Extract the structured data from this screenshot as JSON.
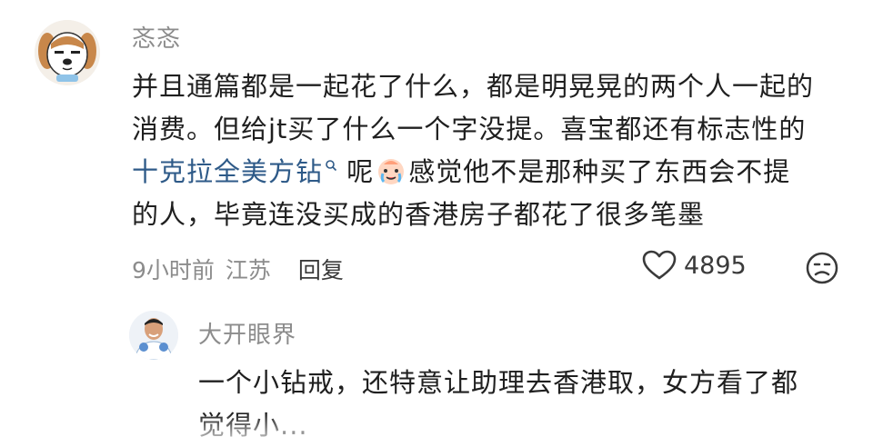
{
  "comment": {
    "username": "忞忞",
    "lines": [
      "并且通篇都是一起花了什么，都是明晃晃的两个人一起的",
      "消费。但给jt买了什么一个字没提。喜宝都还有标志性的"
    ],
    "line3_link": "十克拉全美方钻",
    "line3_after_link": " 呢",
    "line3_rest": "感觉他不是那种买了东西会不提",
    "line4": "的人，毕竟连没买成的香港房子都花了很多笔墨",
    "time": "9小时前",
    "location": "江苏",
    "reply_label": "回复",
    "like_count": "4895"
  },
  "reply": {
    "username": "大开眼界",
    "line1": "一个小钻戒，还特意让助理去香港取，女方看了都",
    "line2": "觉得小..."
  },
  "icons": {
    "like": "heart-outline-icon",
    "dislike": "frown-face-icon",
    "search": "search-icon",
    "emoji": "crying-face-emoji"
  },
  "colors": {
    "link": "#2e5a88",
    "meta": "#8c8c8c",
    "text": "#1f1f1f"
  }
}
